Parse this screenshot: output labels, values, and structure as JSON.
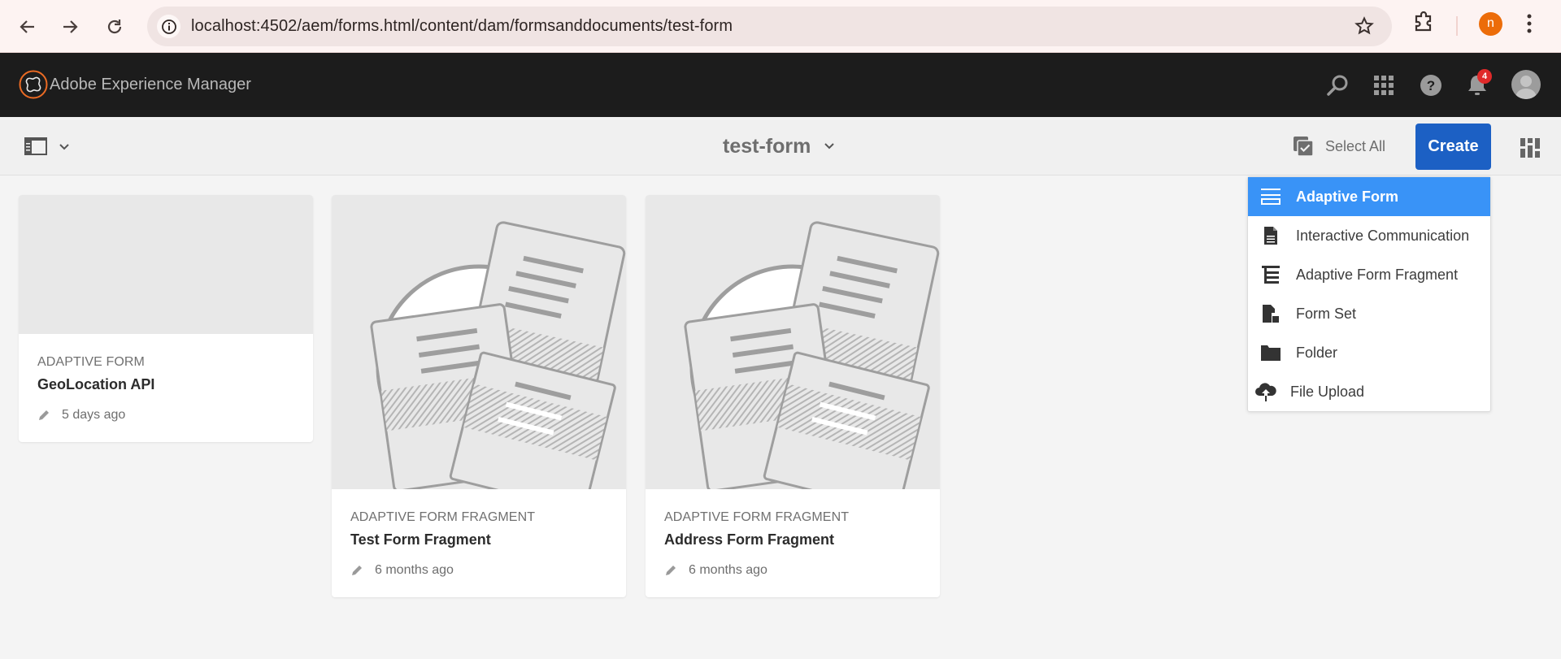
{
  "browser": {
    "url": "localhost:4502/aem/forms.html/content/dam/formsanddocuments/test-form",
    "profile_initial": "n"
  },
  "header": {
    "app_title": "Adobe Experience Manager",
    "notification_count": "4"
  },
  "toolbar": {
    "folder_title": "test-form",
    "select_all_label": "Select All",
    "create_label": "Create"
  },
  "create_menu": {
    "items": [
      {
        "label": "Adaptive Form",
        "icon": "adaptive-form-icon",
        "active": true
      },
      {
        "label": "Interactive Communication",
        "icon": "document-icon",
        "active": false
      },
      {
        "label": "Adaptive Form Fragment",
        "icon": "form-fragment-icon",
        "active": false
      },
      {
        "label": "Form Set",
        "icon": "form-set-icon",
        "active": false
      },
      {
        "label": "Folder",
        "icon": "folder-icon",
        "active": false
      },
      {
        "label": "File Upload",
        "icon": "cloud-upload-icon",
        "active": false
      }
    ]
  },
  "cards": [
    {
      "type": "ADAPTIVE FORM",
      "title": "GeoLocation API",
      "modified": "5 days ago",
      "thumbnail": "blank"
    },
    {
      "type": "ADAPTIVE FORM FRAGMENT",
      "title": "Test Form Fragment",
      "modified": "6 months ago",
      "thumbnail": "documents-illustration"
    },
    {
      "type": "ADAPTIVE FORM FRAGMENT",
      "title": "Address Form Fragment",
      "modified": "6 months ago",
      "thumbnail": "documents-illustration"
    }
  ],
  "colors": {
    "accent": "#1c60c4",
    "menu_highlight": "#3993f7",
    "header_bg": "#1c1c1c",
    "logo_orange": "#eb6b24",
    "badge_red": "#e02a2a"
  }
}
